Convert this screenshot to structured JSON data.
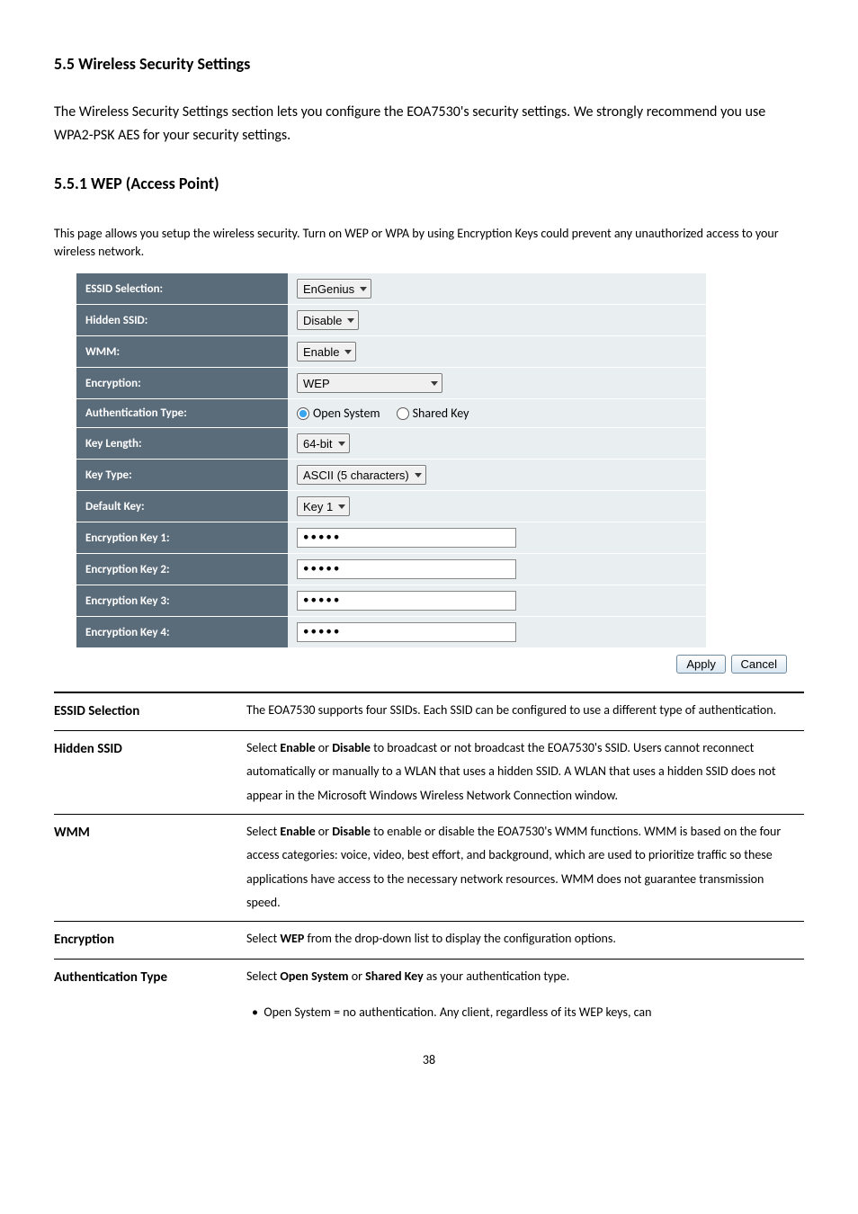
{
  "headings": {
    "section": "5.5 Wireless Security Settings",
    "subsection": "5.5.1 WEP (Access Point)"
  },
  "paragraphs": {
    "intro": "The Wireless Security Settings section lets you configure the EOA7530's security settings. We strongly recommend you use WPA2-PSK AES for your security settings.",
    "note": "This page allows you setup the wireless security. Turn on WEP or WPA by using Encryption Keys could prevent any unauthorized access to your wireless network."
  },
  "form": {
    "rows": {
      "essid": {
        "label": "ESSID Selection:",
        "value": "EnGenius"
      },
      "hidden": {
        "label": "Hidden SSID:",
        "value": "Disable"
      },
      "wmm": {
        "label": "WMM:",
        "value": "Enable"
      },
      "encryption": {
        "label": "Encryption:",
        "value": "WEP"
      },
      "auth": {
        "label": "Authentication Type:",
        "open": "Open System",
        "shared": "Shared Key"
      },
      "keylen": {
        "label": "Key Length:",
        "value": "64-bit"
      },
      "keytype": {
        "label": "Key Type:",
        "value": "ASCII (5 characters)"
      },
      "defkey": {
        "label": "Default Key:",
        "value": "Key 1"
      },
      "k1": {
        "label": "Encryption Key 1:",
        "value": "•••••"
      },
      "k2": {
        "label": "Encryption Key 2:",
        "value": "•••••"
      },
      "k3": {
        "label": "Encryption Key 3:",
        "value": "•••••"
      },
      "k4": {
        "label": "Encryption Key 4:",
        "value": "•••••"
      }
    },
    "buttons": {
      "apply": "Apply",
      "cancel": "Cancel"
    }
  },
  "desc": {
    "essid": {
      "term": "ESSID Selection",
      "text": "The EOA7530 supports four SSIDs. Each SSID can be configured to use a different type of authentication."
    },
    "hidden": {
      "term": "Hidden SSID",
      "pre": "Select ",
      "b1": "Enable",
      "mid1": " or ",
      "b2": "Disable",
      "post": " to broadcast or not broadcast the EOA7530's SSID. Users cannot reconnect automatically or manually to a WLAN that uses a hidden SSID. A WLAN that uses a hidden SSID does not appear in the Microsoft Windows Wireless Network Connection window."
    },
    "wmm": {
      "term": "WMM",
      "pre": "Select ",
      "b1": "Enable",
      "mid1": " or ",
      "b2": "Disable",
      "post": " to enable or disable the EOA7530's WMM functions. WMM is based on the four access categories: voice, video, best effort, and background, which are used to prioritize traffic so these applications have access to the necessary network resources. WMM does not guarantee transmission speed."
    },
    "enc": {
      "term": "Encryption",
      "pre": "Select ",
      "b1": "WEP",
      "post": " from the drop-down list to display the configuration options."
    },
    "auth": {
      "term": "Authentication Type",
      "pre": "Select ",
      "b1": "Open System",
      "mid1": " or ",
      "b2": "Shared Key",
      "post": " as your authentication type.",
      "bullet": "Open System = no authentication. Any client, regardless of its WEP keys, can"
    }
  },
  "pageNumber": "38"
}
